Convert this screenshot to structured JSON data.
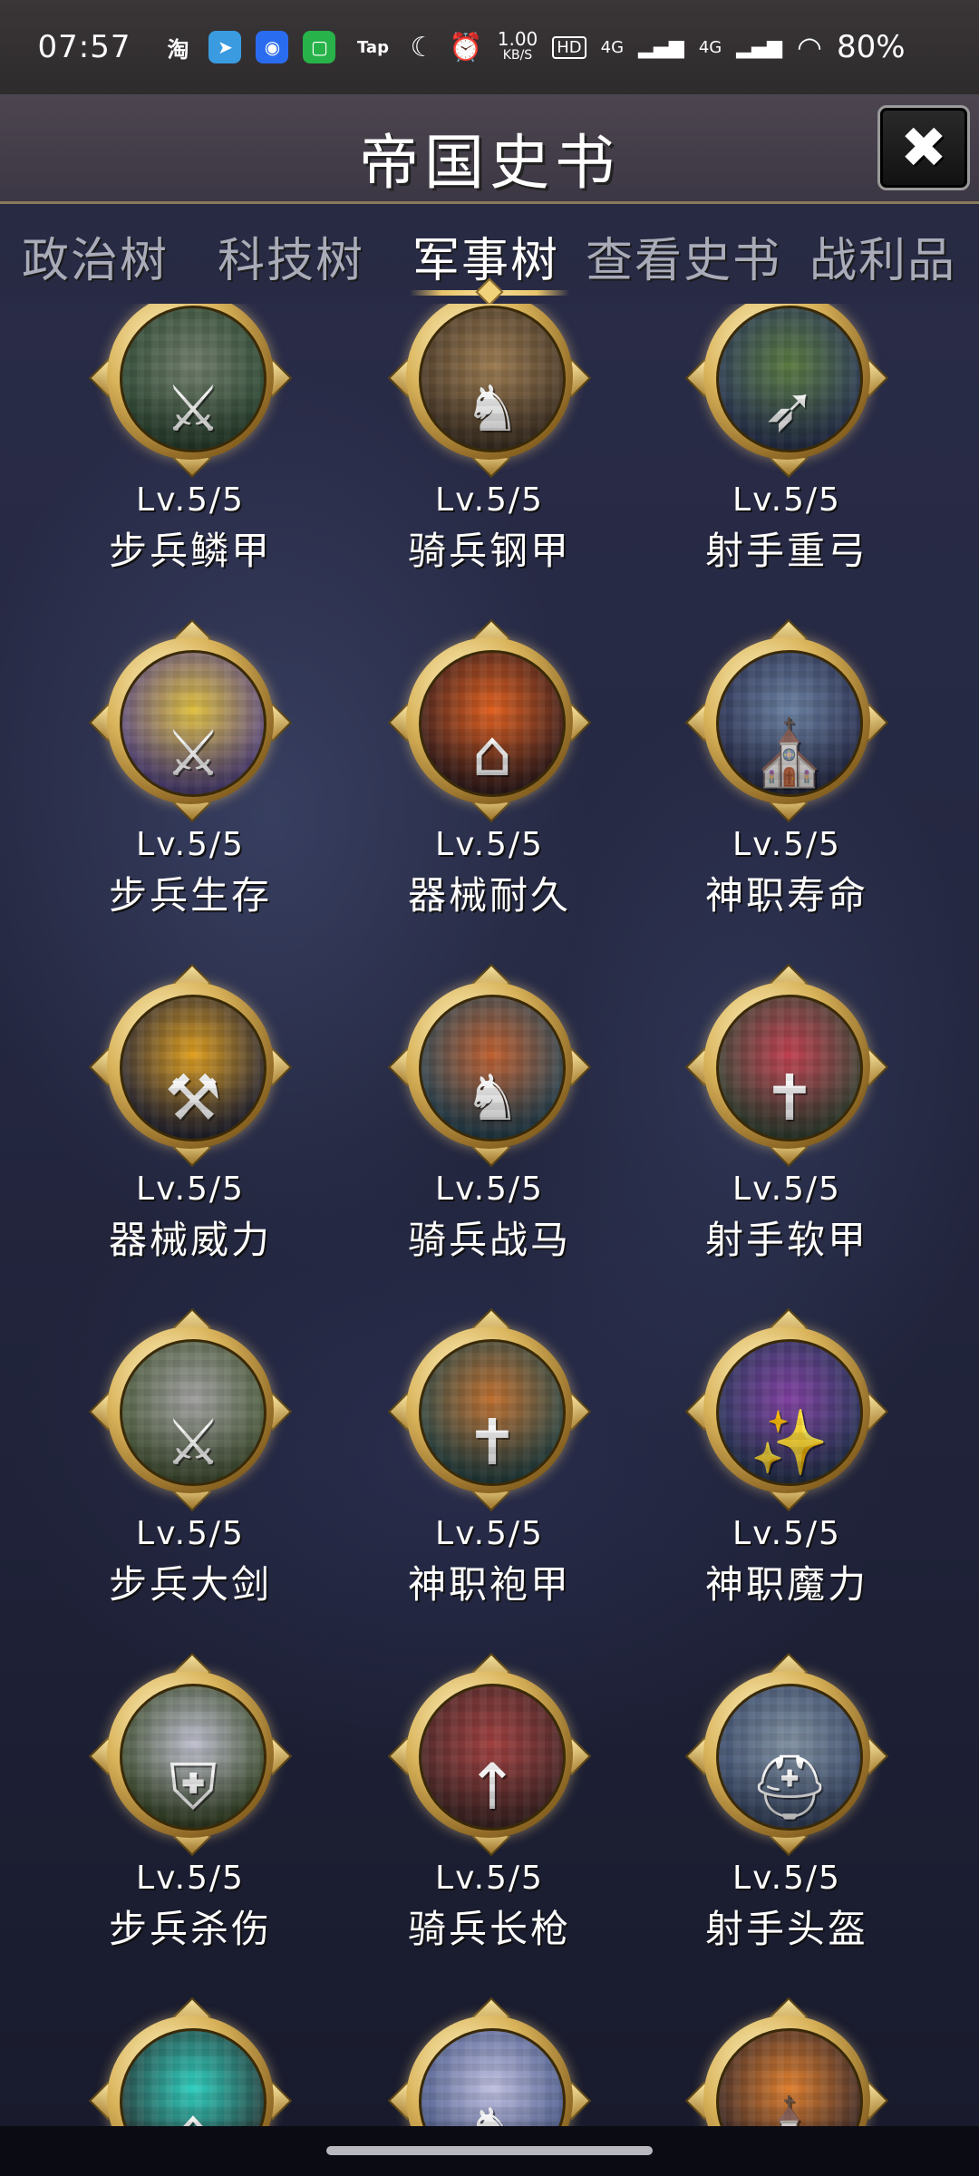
{
  "status_bar": {
    "time": "07:57",
    "app_taobao": "淘",
    "app_tap": "Tap",
    "net_speed_top": "1.00",
    "net_speed_bottom": "KB/S",
    "hd": "HD",
    "signal1": "4G",
    "signal2": "4G",
    "battery": "80%",
    "icons": [
      "taobao-icon",
      "telegram-icon",
      "browser-icon",
      "wechat-mini-icon",
      "taptap-icon",
      "moon-icon",
      "alarm-icon",
      "signal-icon",
      "battery-ring-icon"
    ]
  },
  "header": {
    "title": "帝国史书",
    "close_icon": "close-icon"
  },
  "tabs": [
    {
      "label": "政治树",
      "active": false
    },
    {
      "label": "科技树",
      "active": false
    },
    {
      "label": "军事树",
      "active": true
    },
    {
      "label": "查看史书",
      "active": false
    },
    {
      "label": "战利品",
      "active": false
    }
  ],
  "skills": [
    {
      "level": "Lv.5/5",
      "name": "步兵鳞甲",
      "icon": "knights-icon"
    },
    {
      "level": "Lv.5/5",
      "name": "骑兵钢甲",
      "icon": "cavalry-icon"
    },
    {
      "level": "Lv.5/5",
      "name": "射手重弓",
      "icon": "archers-icon"
    },
    {
      "level": "Lv.5/5",
      "name": "步兵生存",
      "icon": "infantry-survival-icon"
    },
    {
      "level": "Lv.5/5",
      "name": "器械耐久",
      "icon": "burning-siege-icon"
    },
    {
      "level": "Lv.5/5",
      "name": "神职寿命",
      "icon": "cathedral-icon"
    },
    {
      "level": "Lv.5/5",
      "name": "器械威力",
      "icon": "forge-icon"
    },
    {
      "level": "Lv.5/5",
      "name": "骑兵战马",
      "icon": "warhorse-icon"
    },
    {
      "level": "Lv.5/5",
      "name": "射手软甲",
      "icon": "ruins-archer-icon"
    },
    {
      "level": "Lv.5/5",
      "name": "步兵大剑",
      "icon": "greatsword-icon"
    },
    {
      "level": "Lv.5/5",
      "name": "神职袍甲",
      "icon": "monk-robe-icon"
    },
    {
      "level": "Lv.5/5",
      "name": "神职魔力",
      "icon": "priest-magic-icon"
    },
    {
      "level": "Lv.5/5",
      "name": "步兵杀伤",
      "icon": "crusader-icon"
    },
    {
      "level": "Lv.5/5",
      "name": "骑兵长枪",
      "icon": "lance-icon"
    },
    {
      "level": "Lv.5/5",
      "name": "射手头盔",
      "icon": "helmet-icon"
    },
    {
      "level": "",
      "name": "",
      "icon": "siege-ruins-icon"
    },
    {
      "level": "",
      "name": "",
      "icon": "charging-knight-icon"
    },
    {
      "level": "",
      "name": "",
      "icon": "chapel-icon"
    }
  ]
}
